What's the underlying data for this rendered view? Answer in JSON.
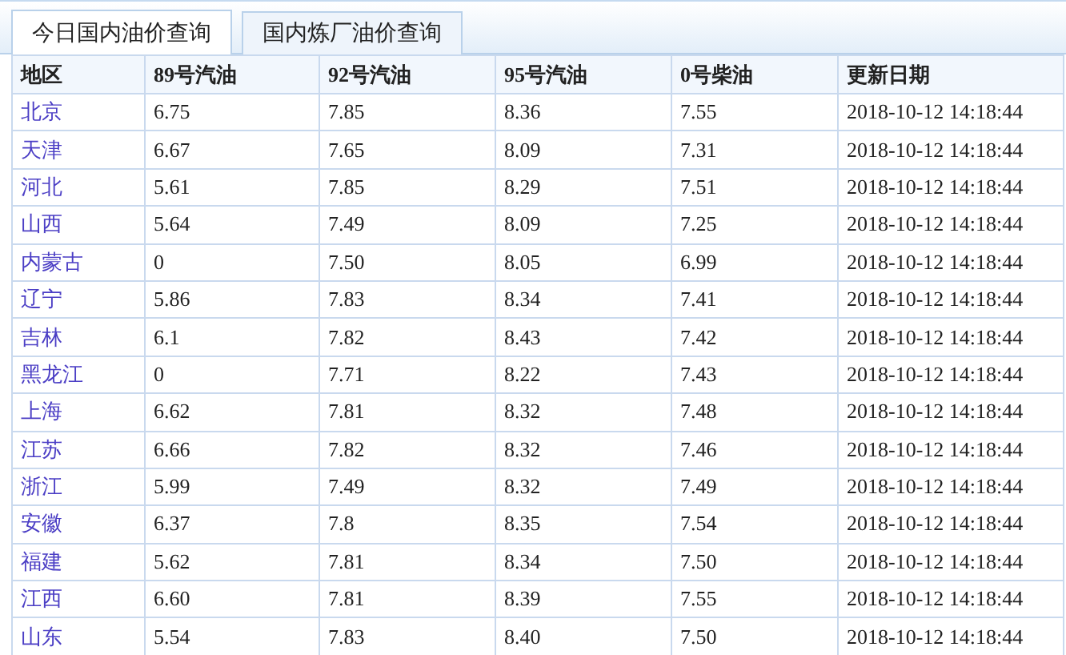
{
  "tabs": [
    {
      "label": "今日国内油价查询",
      "selected": true
    },
    {
      "label": "国内炼厂油价查询",
      "selected": false
    }
  ],
  "table": {
    "columns": [
      "地区",
      "89号汽油",
      "92号汽油",
      "95号汽油",
      "0号柴油",
      "更新日期"
    ],
    "rows": [
      [
        "北京",
        "6.75",
        "7.85",
        "8.36",
        "7.55",
        "2018-10-12 14:18:44"
      ],
      [
        "天津",
        "6.67",
        "7.65",
        "8.09",
        "7.31",
        "2018-10-12 14:18:44"
      ],
      [
        "河北",
        "5.61",
        "7.85",
        "8.29",
        "7.51",
        "2018-10-12 14:18:44"
      ],
      [
        "山西",
        "5.64",
        "7.49",
        "8.09",
        "7.25",
        "2018-10-12 14:18:44"
      ],
      [
        "内蒙古",
        "0",
        "7.50",
        "8.05",
        "6.99",
        "2018-10-12 14:18:44"
      ],
      [
        "辽宁",
        "5.86",
        "7.83",
        "8.34",
        "7.41",
        "2018-10-12 14:18:44"
      ],
      [
        "吉林",
        "6.1",
        "7.82",
        "8.43",
        "7.42",
        "2018-10-12 14:18:44"
      ],
      [
        "黑龙江",
        "0",
        "7.71",
        "8.22",
        "7.43",
        "2018-10-12 14:18:44"
      ],
      [
        "上海",
        "6.62",
        "7.81",
        "8.32",
        "7.48",
        "2018-10-12 14:18:44"
      ],
      [
        "江苏",
        "6.66",
        "7.82",
        "8.32",
        "7.46",
        "2018-10-12 14:18:44"
      ],
      [
        "浙江",
        "5.99",
        "7.49",
        "8.32",
        "7.49",
        "2018-10-12 14:18:44"
      ],
      [
        "安徽",
        "6.37",
        "7.8",
        "8.35",
        "7.54",
        "2018-10-12 14:18:44"
      ],
      [
        "福建",
        "5.62",
        "7.81",
        "8.34",
        "7.50",
        "2018-10-12 14:18:44"
      ],
      [
        "江西",
        "6.60",
        "7.81",
        "8.39",
        "7.55",
        "2018-10-12 14:18:44"
      ],
      [
        "山东",
        "5.54",
        "7.83",
        "8.40",
        "7.50",
        "2018-10-12 14:18:44"
      ]
    ]
  }
}
